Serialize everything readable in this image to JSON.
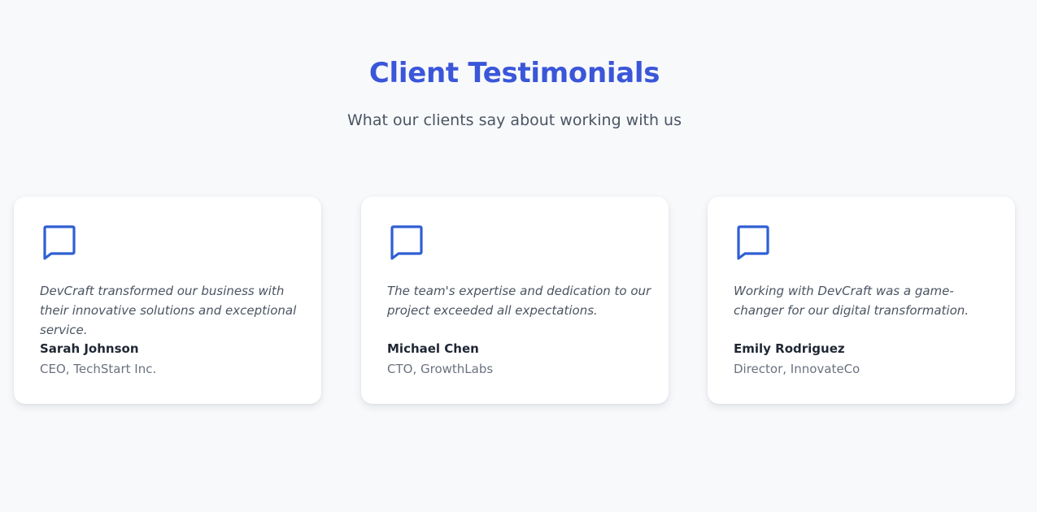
{
  "section": {
    "title": "Client Testimonials",
    "subtitle": "What our clients say about working with us"
  },
  "colors": {
    "accent": "#3a56d9",
    "icon": "#2f5fd3",
    "background": "#f8f9fb",
    "card": "#ffffff"
  },
  "testimonials": [
    {
      "icon": "speech-bubble-icon",
      "quote": "DevCraft transformed our business with their innovative solutions and exceptional service.",
      "name": "Sarah Johnson",
      "role": "CEO, TechStart Inc."
    },
    {
      "icon": "speech-bubble-icon",
      "quote": "The team's expertise and dedication to our project exceeded all expectations.",
      "name": "Michael Chen",
      "role": "CTO, GrowthLabs"
    },
    {
      "icon": "speech-bubble-icon",
      "quote": "Working with DevCraft was a game-changer for our digital transformation.",
      "name": "Emily Rodriguez",
      "role": "Director, InnovateCo"
    }
  ]
}
